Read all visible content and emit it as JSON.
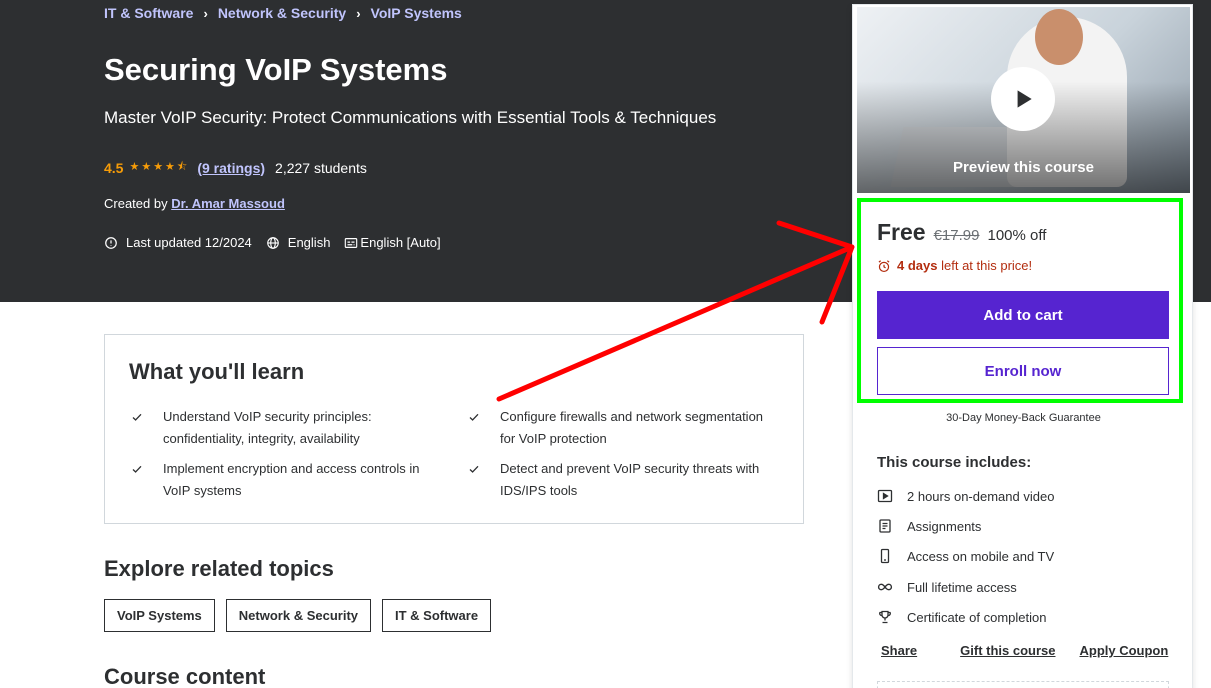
{
  "breadcrumb": [
    "IT & Software",
    "Network & Security",
    "VoIP Systems"
  ],
  "course": {
    "title": "Securing VoIP Systems",
    "subtitle": "Master VoIP Security: Protect Communications with Essential Tools & Techniques",
    "rating": "4.5",
    "rating_value": 4.5,
    "ratings_link": "(9 ratings)",
    "students": "2,227 students",
    "created_by_label": "Created by",
    "author": "Dr. Amar Massoud",
    "last_updated": "Last updated 12/2024",
    "language": "English",
    "captions": "English [Auto]"
  },
  "learn": {
    "title": "What you'll learn",
    "items": [
      "Understand VoIP security principles: confidentiality, integrity, availability",
      "Configure firewalls and network segmentation for VoIP protection",
      "Implement encryption and access controls in VoIP systems",
      "Detect and prevent VoIP security threats with IDS/IPS tools"
    ]
  },
  "topics": {
    "title": "Explore related topics",
    "chips": [
      "VoIP Systems",
      "Network & Security",
      "IT & Software"
    ]
  },
  "content_section": {
    "title": "Course content"
  },
  "sidebar": {
    "preview_label": "Preview this course",
    "price": "Free",
    "original_price": "€17.99",
    "discount": "100% off",
    "deadline_days": "4 days",
    "deadline_text": "left at this price!",
    "add_to_cart": "Add to cart",
    "enroll_now": "Enroll now",
    "guarantee": "30-Day Money-Back Guarantee",
    "includes_title": "This course includes:",
    "includes": [
      {
        "icon": "video-icon",
        "label": "2 hours on-demand video"
      },
      {
        "icon": "assignment-icon",
        "label": "Assignments"
      },
      {
        "icon": "mobile-icon",
        "label": "Access on mobile and TV"
      },
      {
        "icon": "infinity-icon",
        "label": "Full lifetime access"
      },
      {
        "icon": "trophy-icon",
        "label": "Certificate of completion"
      }
    ],
    "links": {
      "share": "Share",
      "gift": "Gift this course",
      "coupon": "Apply Coupon"
    }
  },
  "colors": {
    "hero_bg": "#2d2f31",
    "link_purple_light": "#c0c4fc",
    "star": "#f69c08",
    "brand_purple": "#5624d0",
    "deadline_red": "#b32d0f",
    "annotation_red": "#ff0000",
    "annotation_green": "#00ff00"
  }
}
